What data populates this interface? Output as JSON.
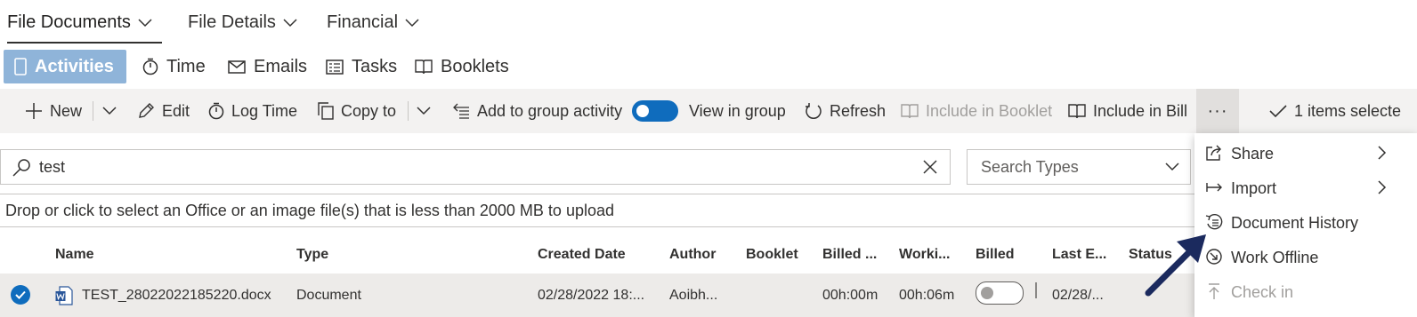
{
  "top_nav": {
    "items": [
      {
        "label": "File Documents"
      },
      {
        "label": "File Details"
      },
      {
        "label": "Financial"
      }
    ]
  },
  "view_tabs": [
    {
      "label": "Activities"
    },
    {
      "label": "Time"
    },
    {
      "label": "Emails"
    },
    {
      "label": "Tasks"
    },
    {
      "label": "Booklets"
    }
  ],
  "toolbar": {
    "new_label": "New",
    "edit_label": "Edit",
    "log_time_label": "Log Time",
    "copy_to_label": "Copy to",
    "add_to_group_label": "Add to group activity",
    "view_in_group_label": "View in group",
    "view_in_group_on": true,
    "refresh_label": "Refresh",
    "include_in_booklet_label": "Include in Booklet",
    "include_in_bill_label": "Include in Bill",
    "more_label": "···",
    "selected_label": "1 items selecte"
  },
  "search": {
    "value": "test",
    "types_placeholder": "Search Types"
  },
  "upload": {
    "text": "Drop or click to select an Office or an image file(s) that is less than 2000 MB to upload"
  },
  "table": {
    "columns": [
      "Name",
      "Type",
      "Created Date",
      "Author",
      "Booklet",
      "Billed ...",
      "Worki...",
      "Billed",
      "Last E...",
      "Status"
    ],
    "rows": [
      {
        "selected": true,
        "name": "TEST_28022022185220.docx",
        "type": "Document",
        "created": "02/28/2022 18:...",
        "author": "Aoibh...",
        "booklet": "",
        "billed_time": "00h:00m",
        "working": "00h:06m",
        "billed": false,
        "last_edited": "02/28/...",
        "status": ""
      }
    ]
  },
  "context_menu": {
    "items": [
      {
        "label": "Share",
        "icon": "share-icon",
        "submenu": true
      },
      {
        "label": "Import",
        "icon": "import-icon",
        "submenu": true
      },
      {
        "label": "Document History",
        "icon": "history-icon",
        "submenu": false
      },
      {
        "label": "Work Offline",
        "icon": "work-offline-icon",
        "submenu": false
      },
      {
        "label": "Check in",
        "icon": "check-in-icon",
        "submenu": false,
        "disabled": true
      }
    ]
  },
  "colors": {
    "accent": "#0f6cbd",
    "active_tab_bg": "#8fb4d9",
    "annotation_arrow": "#1b2a5e"
  }
}
